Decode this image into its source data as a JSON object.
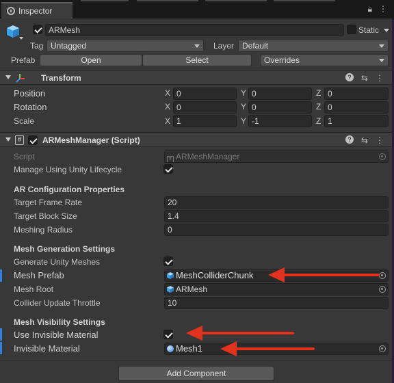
{
  "tab": {
    "title": "Inspector"
  },
  "object": {
    "name": "ARMesh",
    "static_label": "Static",
    "tag_label": "Tag",
    "tag_value": "Untagged",
    "layer_label": "Layer",
    "layer_value": "Default",
    "prefab_label": "Prefab",
    "prefab_open": "Open",
    "prefab_select": "Select",
    "prefab_overrides": "Overrides"
  },
  "transform": {
    "title": "Transform",
    "rows": [
      {
        "label": "Position",
        "x": "0",
        "y": "0",
        "z": "0"
      },
      {
        "label": "Rotation",
        "x": "0",
        "y": "0",
        "z": "0"
      },
      {
        "label": "Scale",
        "x": "1",
        "y": "-1",
        "z": "1"
      }
    ],
    "axis": {
      "x": "X",
      "y": "Y",
      "z": "Z"
    }
  },
  "script": {
    "title": "ARMeshManager (Script)",
    "script_label": "Script",
    "script_value": "ARMeshManager",
    "lifecycle_label": "Manage Using Unity Lifecycle",
    "lifecycle_checked": true,
    "ar_config_header": "AR Configuration Properties",
    "frame_rate_label": "Target Frame Rate",
    "frame_rate_value": "20",
    "block_size_label": "Target Block Size",
    "block_size_value": "1.4",
    "meshing_radius_label": "Meshing Radius",
    "meshing_radius_value": "0",
    "mesh_gen_header": "Mesh Generation Settings",
    "gen_meshes_label": "Generate Unity Meshes",
    "gen_meshes_checked": true,
    "mesh_prefab_label": "Mesh Prefab",
    "mesh_prefab_value": "MeshColliderChunk",
    "mesh_root_label": "Mesh Root",
    "mesh_root_value": "ARMesh",
    "collider_throttle_label": "Collider Update Throttle",
    "collider_throttle_value": "10",
    "mesh_vis_header": "Mesh Visibility Settings",
    "use_invisible_label": "Use Invisible Material",
    "use_invisible_checked": true,
    "invisible_material_label": "Invisible Material",
    "invisible_material_value": "Mesh1"
  },
  "footer": {
    "add_component": "Add Component"
  },
  "colors": {
    "annotation_arrow": "#e2311d",
    "highlight_bar": "#2f7fdc",
    "panel_bg": "#383838"
  },
  "icons": [
    "inspector-icon",
    "lock-icon",
    "menu-icon",
    "cube-icon",
    "transform-icon",
    "script-icon",
    "help-icon",
    "settings-icon",
    "more-icon",
    "prefab-icon",
    "material-icon",
    "object-picker-icon"
  ]
}
